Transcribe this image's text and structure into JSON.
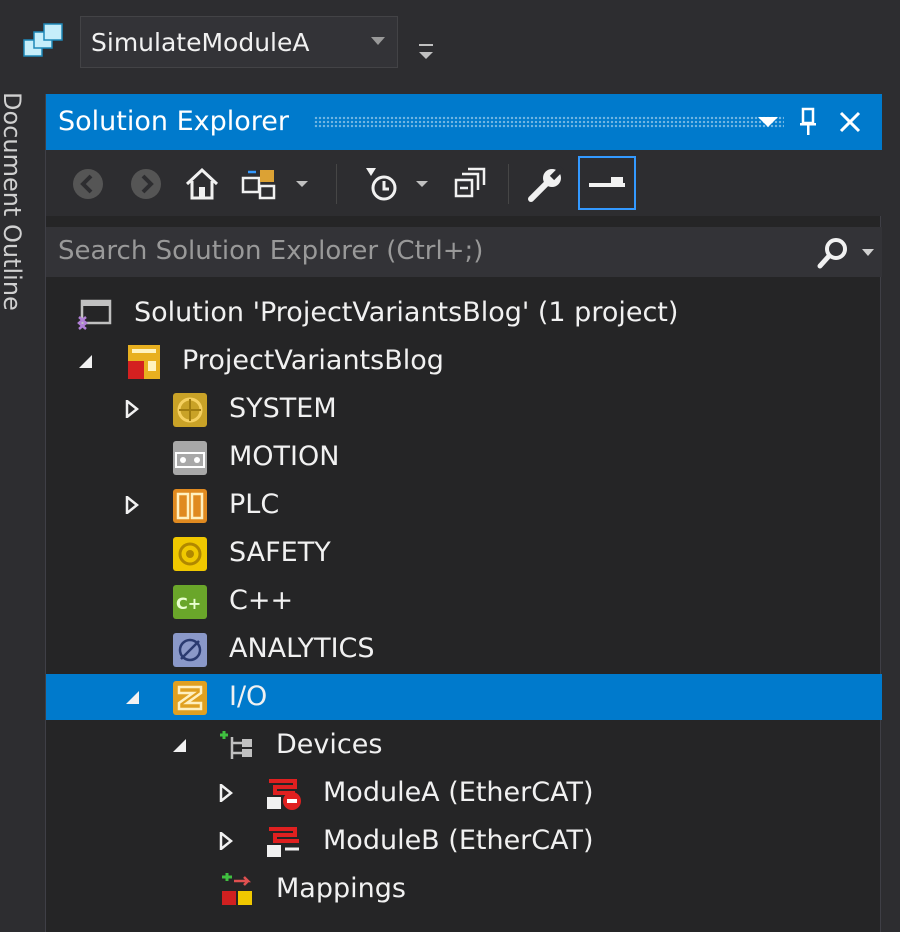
{
  "toolbar": {
    "configuration": "SimulateModuleA"
  },
  "side_panel": {
    "label": "Document Outline"
  },
  "solution_explorer": {
    "title": "Solution Explorer",
    "search_placeholder": "Search Solution Explorer (Ctrl+;)",
    "tree": [
      {
        "label": "Solution 'ProjectVariantsBlog' (1 project)",
        "icon": "solution-icon",
        "expander": "none",
        "level": 0
      },
      {
        "label": "ProjectVariantsBlog",
        "icon": "twincat-project-icon",
        "expander": "expanded",
        "level": 0
      },
      {
        "label": "SYSTEM",
        "icon": "system-icon",
        "expander": "collapsed",
        "level": 1
      },
      {
        "label": "MOTION",
        "icon": "motion-icon",
        "expander": "none",
        "level": 1
      },
      {
        "label": "PLC",
        "icon": "plc-icon",
        "expander": "collapsed",
        "level": 1
      },
      {
        "label": "SAFETY",
        "icon": "safety-icon",
        "expander": "none",
        "level": 1
      },
      {
        "label": "C++",
        "icon": "cpp-icon",
        "expander": "none",
        "level": 1
      },
      {
        "label": "ANALYTICS",
        "icon": "analytics-icon",
        "expander": "none",
        "level": 1
      },
      {
        "label": "I/O",
        "icon": "io-icon",
        "expander": "expanded",
        "level": 1,
        "selected": true
      },
      {
        "label": "Devices",
        "icon": "devices-icon",
        "expander": "expanded",
        "level": 2
      },
      {
        "label": "ModuleA (EtherCAT)",
        "icon": "ethercat-disabled-icon",
        "expander": "collapsed",
        "level": 3
      },
      {
        "label": "ModuleB (EtherCAT)",
        "icon": "ethercat-icon",
        "expander": "collapsed",
        "level": 3
      },
      {
        "label": "Mappings",
        "icon": "mappings-icon",
        "expander": "none",
        "level": 2
      }
    ]
  },
  "colors": {
    "accent": "#007acc",
    "background": "#252526",
    "chrome": "#2d2d30"
  }
}
